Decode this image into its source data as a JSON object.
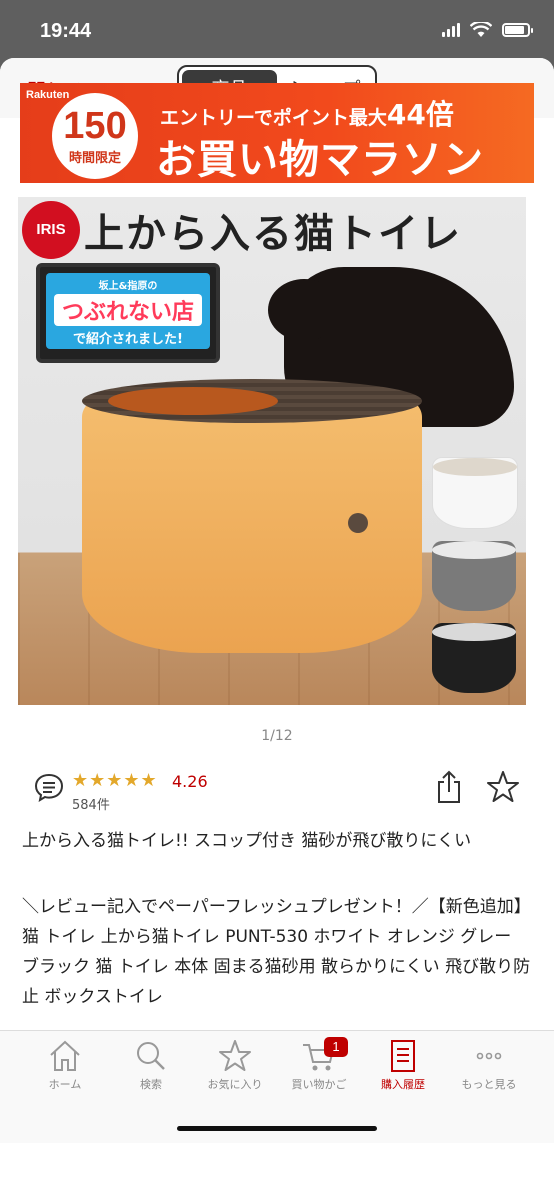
{
  "status_bar": {
    "time": "19:44"
  },
  "header": {
    "close_label": "閉じる",
    "tabs": [
      {
        "label": "商品",
        "active": true
      },
      {
        "label": "ショップ",
        "active": false
      }
    ]
  },
  "banner": {
    "brand": "Rakuten",
    "badge_number": "150",
    "badge_sub": "時間限定",
    "line1_prefix": "エントリーでポイント最大",
    "line1_multiplier": "44倍",
    "line2": "お買い物マラソン"
  },
  "product_image": {
    "logo_text": "IRIS",
    "title": "上から入る猫トイレ",
    "tv_line1": "坂上&指原の",
    "tv_line2": "つぶれない店",
    "tv_line3": "で紹介されました!"
  },
  "pager": "1/12",
  "review": {
    "stars": "★★★★★",
    "rating": "4.26",
    "count": "584件"
  },
  "product": {
    "title": "上から入る猫トイレ!! スコップ付き 猫砂が飛び散りにくい",
    "description": "＼レビュー記入でペーパーフレッシュプレゼント！／【新色追加】猫 トイレ 上から猫トイレ PUNT-530 ホワイト オレンジ グレー ブラック 猫 トイレ 本体 固まる猫砂用 散らかりにくい 飛び散り防止 ボックストイレ"
  },
  "tabbar": {
    "items": [
      {
        "label": "ホーム",
        "icon": "home-icon"
      },
      {
        "label": "検索",
        "icon": "search-icon"
      },
      {
        "label": "お気に入り",
        "icon": "star-icon"
      },
      {
        "label": "買い物かご",
        "icon": "cart-icon",
        "badge": "1"
      },
      {
        "label": "購入履歴",
        "icon": "receipt-icon",
        "active": true
      },
      {
        "label": "もっと見る",
        "icon": "more-icon"
      }
    ]
  },
  "colors": {
    "accent": "#bf0000",
    "star": "#e3a82b",
    "banner": "#f24a1c"
  }
}
